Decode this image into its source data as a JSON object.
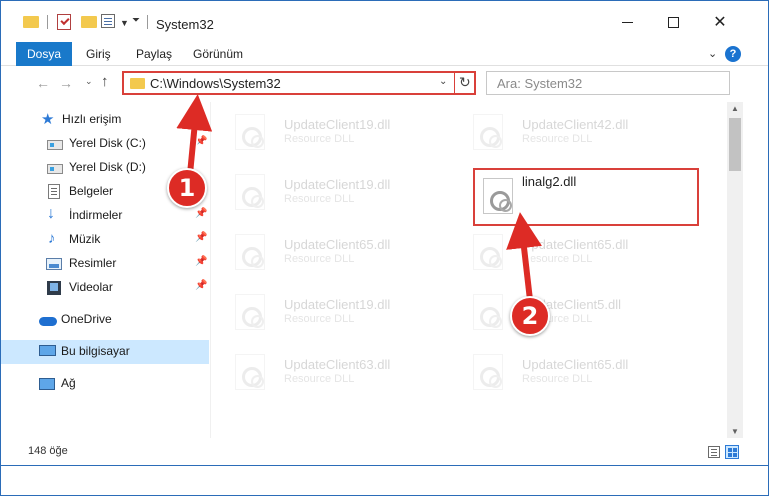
{
  "window": {
    "title": "System32"
  },
  "ribbon": {
    "tabs": [
      "Dosya",
      "Giriş",
      "Paylaş",
      "Görünüm"
    ],
    "help": "?"
  },
  "navigation": {
    "address": "C:\\Windows\\System32",
    "search_placeholder": "Ara: System32"
  },
  "sidebar": {
    "items": [
      {
        "label": "Hızlı erişim",
        "icon": "star-icon"
      },
      {
        "label": "Yerel Disk (C:)",
        "icon": "drive-icon"
      },
      {
        "label": "Yerel Disk (D:)",
        "icon": "drive-icon"
      },
      {
        "label": "Belgeler",
        "icon": "document-icon"
      },
      {
        "label": "İndirmeler",
        "icon": "download-icon"
      },
      {
        "label": "Müzik",
        "icon": "music-icon"
      },
      {
        "label": "Resimler",
        "icon": "pictures-icon"
      },
      {
        "label": "Videolar",
        "icon": "video-icon"
      },
      {
        "label": "OneDrive",
        "icon": "cloud-icon"
      },
      {
        "label": "Bu bilgisayar",
        "icon": "computer-icon"
      },
      {
        "label": "Ağ",
        "icon": "network-icon"
      }
    ]
  },
  "files": {
    "left_column": [
      {
        "name": "UpdateClient19.dll",
        "type": "Resource DLL"
      },
      {
        "name": "UpdateClient19.dll",
        "type": "Resource DLL"
      },
      {
        "name": "UpdateClient65.dll",
        "type": "Resource DLL"
      },
      {
        "name": "UpdateClient19.dll",
        "type": "Resource DLL"
      },
      {
        "name": "UpdateClient63.dll",
        "type": "Resource DLL"
      }
    ],
    "right_column": [
      {
        "name": "UpdateClient42.dll",
        "type": "Resource DLL"
      },
      {
        "name": "UpdateClient65.dll",
        "type": "Resource DLL"
      },
      {
        "name": "UpdateClient5.dll",
        "type": "Resource DLL"
      },
      {
        "name": "UpdateClient65.dll",
        "type": "Resource DLL"
      }
    ],
    "highlighted": {
      "name": "linalg2.dll"
    }
  },
  "status": {
    "item_count": "148 öğe"
  },
  "annotations": {
    "step1": "1",
    "step2": "2",
    "color": "#dd2b25"
  }
}
